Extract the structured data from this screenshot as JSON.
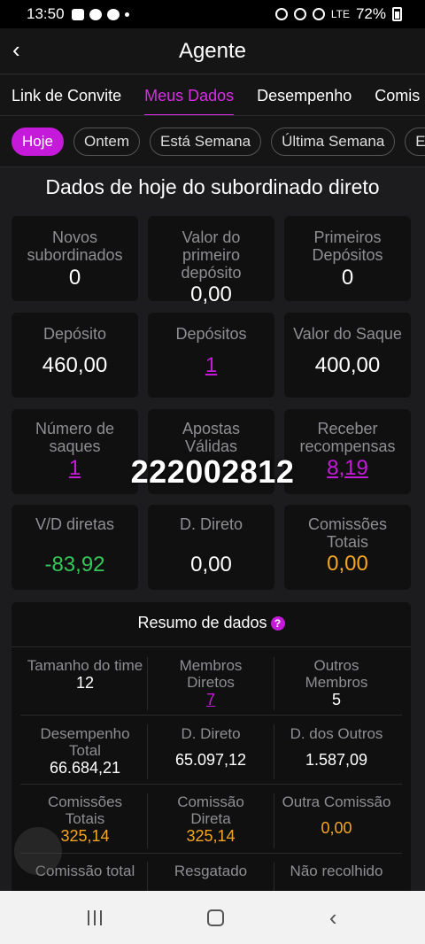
{
  "status_bar": {
    "time": "13:50",
    "battery": "72%",
    "network": "LTE"
  },
  "header": {
    "title": "Agente"
  },
  "tabs": [
    "Link de Convite",
    "Meus Dados",
    "Desempenho",
    "Comis"
  ],
  "chips": [
    "Hoje",
    "Ontem",
    "Está Semana",
    "Última Semana",
    "Es"
  ],
  "section_title": "Dados de hoje do subordinado direto",
  "cards": [
    {
      "label": "Novos subordinados",
      "value": "0"
    },
    {
      "label": "Valor do primeiro depósito",
      "value": "0,00"
    },
    {
      "label": "Primeiros Depósitos",
      "value": "0"
    },
    {
      "label": "Depósito",
      "value": "460,00"
    },
    {
      "label": "Depósitos",
      "value": "1"
    },
    {
      "label": "Valor do Saque",
      "value": "400,00"
    },
    {
      "label": "Número de saques",
      "value": "1"
    },
    {
      "label": "Apostas Válidas",
      "value": ""
    },
    {
      "label": "Receber recompensas",
      "value": "8,19"
    },
    {
      "label": "V/D diretas",
      "value": "-83,92"
    },
    {
      "label": "D. Direto",
      "value": "0,00"
    },
    {
      "label": "Comissões Totais",
      "value": "0,00"
    }
  ],
  "overlay_number": "222002812",
  "summary": {
    "title": "Resumo de dados",
    "help_icon": "?",
    "rows": [
      [
        {
          "label": "Tamanho do time",
          "value": "12"
        },
        {
          "label": "Membros Diretos",
          "value": "7"
        },
        {
          "label": "Outros Membros",
          "value": "5"
        }
      ],
      [
        {
          "label": "Desempenho Total",
          "value": "66.684,21"
        },
        {
          "label": "D. Direto",
          "value": "65.097,12"
        },
        {
          "label": "D. dos Outros",
          "value": "1.587,09"
        }
      ],
      [
        {
          "label": "Comissões Totais",
          "value": "325,14"
        },
        {
          "label": "Comissão Direta",
          "value": "325,14"
        },
        {
          "label": "Outra Comissão",
          "value": "0,00"
        }
      ],
      [
        {
          "label": "Comissão total",
          "value": ""
        },
        {
          "label": "Resgatado",
          "value": ""
        },
        {
          "label": "Não recolhido",
          "value": ""
        }
      ]
    ]
  },
  "colors": {
    "accent": "#c51ad9",
    "positive": "#34c759",
    "orange": "#f5a623",
    "label_gray": "#8e8e93"
  }
}
